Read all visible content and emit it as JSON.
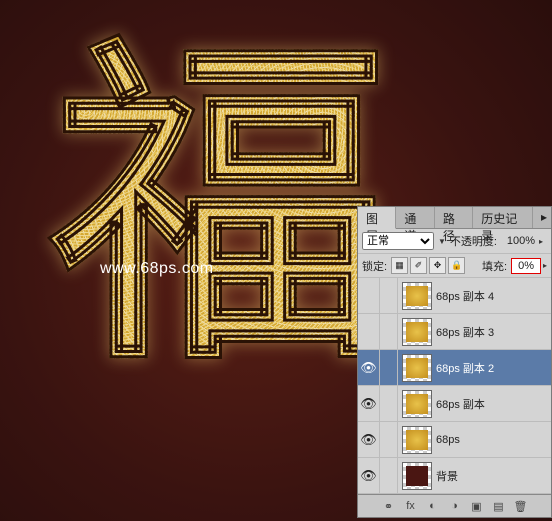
{
  "canvas": {
    "watermark": "www.68ps.com",
    "artwork_char": "福"
  },
  "panel": {
    "tabs": {
      "layers": "图层",
      "channels": "通道",
      "paths": "路径",
      "history": "历史记录"
    },
    "blend_mode": "正常",
    "opacity_label": "不透明度:",
    "opacity_value": "100%",
    "lock_label": "锁定:",
    "fill_label": "填充:",
    "fill_value": "0%",
    "layers": [
      {
        "visible": false,
        "name": "68ps 副本 4",
        "selected": false,
        "thumb": "fx"
      },
      {
        "visible": false,
        "name": "68ps 副本 3",
        "selected": false,
        "thumb": "fx"
      },
      {
        "visible": true,
        "name": "68ps 副本 2",
        "selected": true,
        "thumb": "fx"
      },
      {
        "visible": true,
        "name": "68ps 副本",
        "selected": false,
        "thumb": "fx"
      },
      {
        "visible": true,
        "name": "68ps",
        "selected": false,
        "thumb": "fx"
      },
      {
        "visible": true,
        "name": "背景",
        "selected": false,
        "thumb": "bg"
      }
    ]
  }
}
